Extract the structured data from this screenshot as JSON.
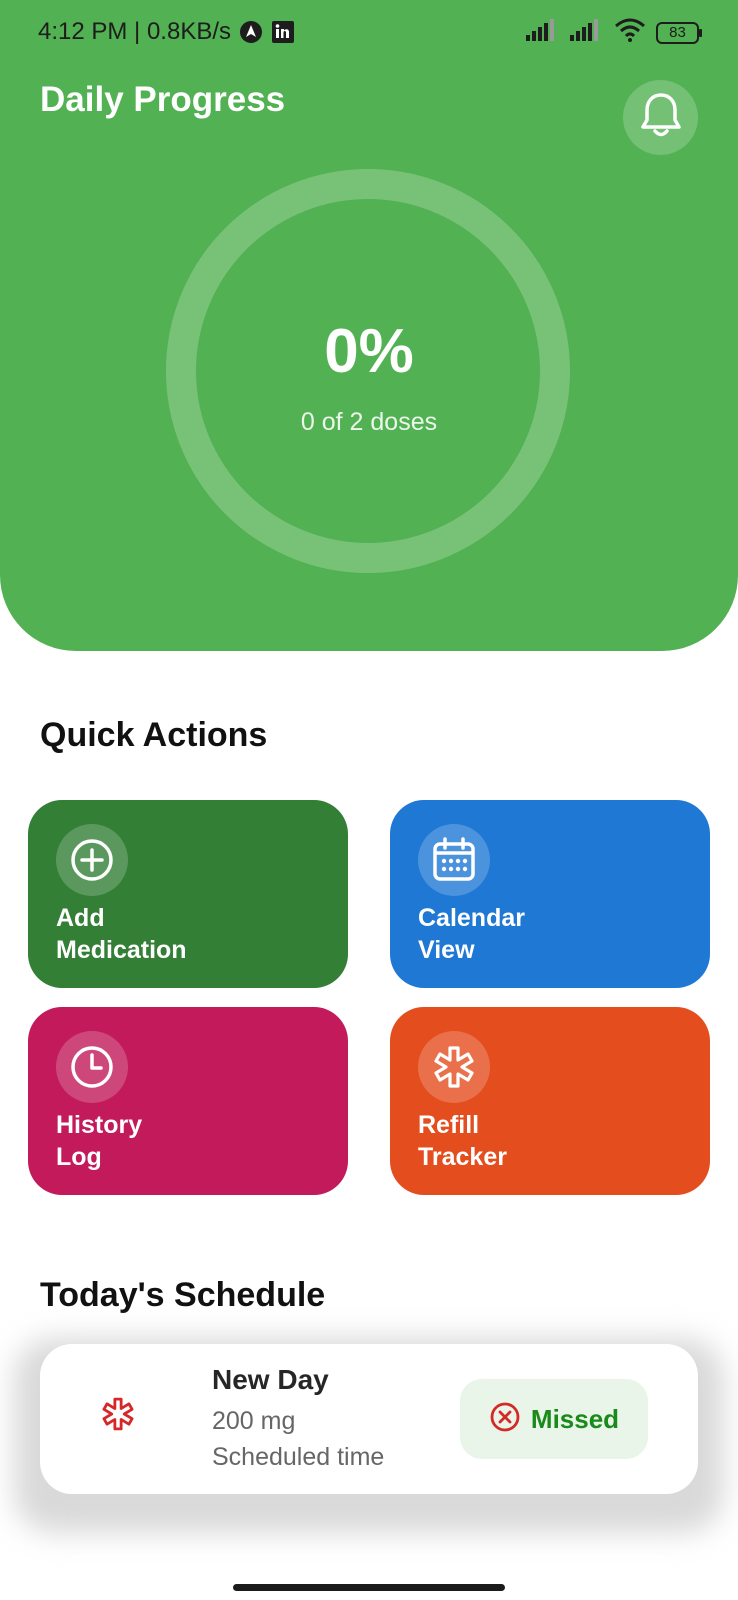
{
  "status_bar": {
    "time_speed": "4:12 PM | 0.8KB/s",
    "battery": "83",
    "icons": [
      "navigation-app-icon",
      "linkedin-icon",
      "signal-icon",
      "signal-icon",
      "wifi-icon",
      "battery-icon"
    ]
  },
  "header": {
    "title": "Daily Progress",
    "bell_icon": "bell-icon",
    "progress_percent": "0%",
    "progress_caption": "0 of 2 doses",
    "progress_fraction": 0,
    "color": "#52b152"
  },
  "quick_actions": {
    "title": "Quick Actions",
    "cards": [
      {
        "line1": "Add",
        "line2": "Medication",
        "icon": "add-circle-icon",
        "color": "#327f35"
      },
      {
        "line1": "Calendar",
        "line2": "View",
        "icon": "calendar-icon",
        "color": "#1e78d4"
      },
      {
        "line1": "History",
        "line2": "Log",
        "icon": "clock-icon",
        "color": "#c21a5b"
      },
      {
        "line1": "Refill",
        "line2": "Tracker",
        "icon": "medical-star-icon",
        "color": "#e44d1e"
      }
    ]
  },
  "schedule": {
    "title": "Today's Schedule",
    "items": [
      {
        "name": "New Day",
        "dose": "200 mg",
        "time": "Scheduled time",
        "status": "Missed",
        "icon": "medical-star-icon",
        "status_color": "#1a8a1a"
      }
    ]
  }
}
